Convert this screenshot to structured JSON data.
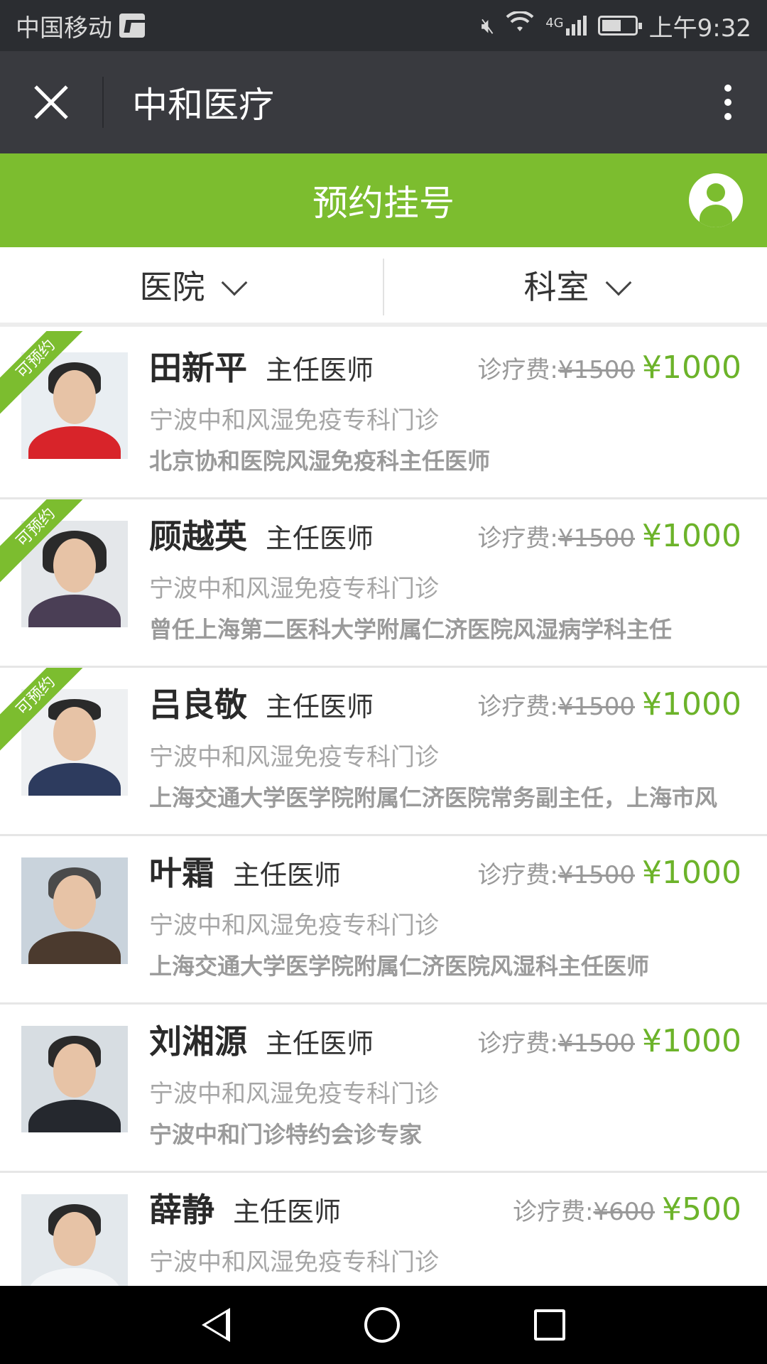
{
  "status_bar": {
    "carrier": "中国移动",
    "network": "4G",
    "time": "上午9:32"
  },
  "title_bar": {
    "title": "中和医疗",
    "close_icon": "close-icon",
    "more_icon": "more-vertical-icon"
  },
  "header": {
    "title": "预约挂号",
    "user_icon": "user-icon",
    "accent_color": "#7cbd2f"
  },
  "filters": [
    {
      "label": "医院"
    },
    {
      "label": "科室"
    }
  ],
  "fee_label": "诊疗费:",
  "doctors": [
    {
      "name": "田新平",
      "title": "主任医师",
      "old_price": "¥1500",
      "price": "¥1000",
      "clinic": "宁波中和风湿免疫专科门诊",
      "desc": "北京协和医院风湿免疫科主任医师",
      "badge": "可预约"
    },
    {
      "name": "顾越英",
      "title": "主任医师",
      "old_price": "¥1500",
      "price": "¥1000",
      "clinic": "宁波中和风湿免疫专科门诊",
      "desc": "曾任上海第二医科大学附属仁济医院风湿病学科主任",
      "badge": "可预约"
    },
    {
      "name": "吕良敬",
      "title": "主任医师",
      "old_price": "¥1500",
      "price": "¥1000",
      "clinic": "宁波中和风湿免疫专科门诊",
      "desc": "上海交通大学医学院附属仁济医院常务副主任，上海市风",
      "badge": "可预约"
    },
    {
      "name": "叶霜",
      "title": "主任医师",
      "old_price": "¥1500",
      "price": "¥1000",
      "clinic": "宁波中和风湿免疫专科门诊",
      "desc": "上海交通大学医学院附属仁济医院风湿科主任医师",
      "badge": ""
    },
    {
      "name": "刘湘源",
      "title": "主任医师",
      "old_price": "¥1500",
      "price": "¥1000",
      "clinic": "宁波中和风湿免疫专科门诊",
      "desc": "宁波中和门诊特约会诊专家",
      "badge": ""
    },
    {
      "name": "薛静",
      "title": "主任医师",
      "old_price": "¥600",
      "price": "¥500",
      "clinic": "宁波中和风湿免疫专科门诊",
      "desc": "",
      "badge": ""
    }
  ]
}
